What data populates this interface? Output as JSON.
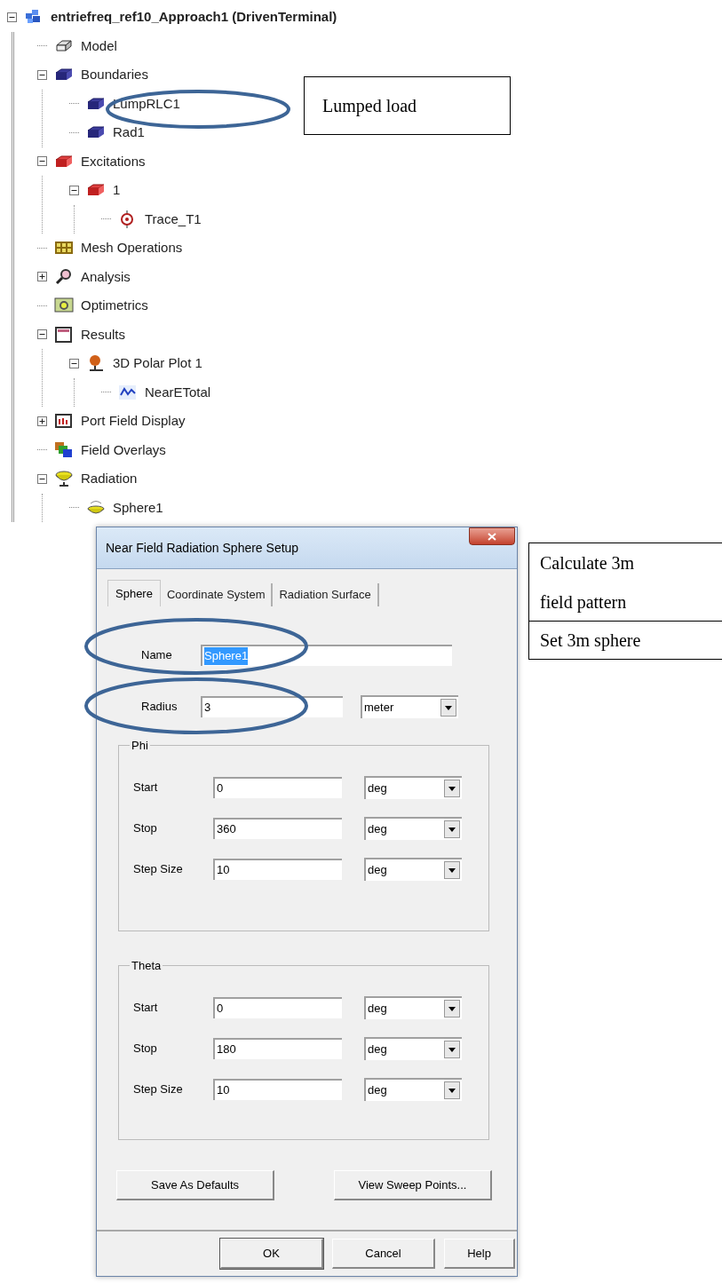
{
  "tree": [
    {
      "label": "entriefreq_ref10_Approach1 (DrivenTerminal)",
      "kind": "project",
      "expanded": true,
      "children": [
        {
          "label": "Model",
          "kind": "model"
        },
        {
          "label": "Boundaries",
          "kind": "boundary",
          "expanded": true,
          "children": [
            {
              "label": "LumpRLC1",
              "kind": "boundary"
            },
            {
              "label": "Rad1",
              "kind": "boundary"
            }
          ]
        },
        {
          "label": "Excitations",
          "kind": "excitation",
          "expanded": true,
          "children": [
            {
              "label": "1",
              "kind": "excitation",
              "expanded": true,
              "children": [
                {
                  "label": "Trace_T1",
                  "kind": "trace"
                }
              ]
            }
          ]
        },
        {
          "label": "Mesh Operations",
          "kind": "mesh"
        },
        {
          "label": "Analysis",
          "kind": "analysis",
          "expanded": false
        },
        {
          "label": "Optimetrics",
          "kind": "optimetrics"
        },
        {
          "label": "Results",
          "kind": "results",
          "expanded": true,
          "children": [
            {
              "label": "3D Polar Plot 1",
              "kind": "polar",
              "expanded": true,
              "children": [
                {
                  "label": "NearETotal",
                  "kind": "curve"
                }
              ]
            }
          ]
        },
        {
          "label": "Port Field Display",
          "kind": "port",
          "expanded": false
        },
        {
          "label": "Field Overlays",
          "kind": "overlays"
        },
        {
          "label": "Radiation",
          "kind": "radiation",
          "expanded": true,
          "children": [
            {
              "label": "Sphere1",
              "kind": "sphere"
            }
          ]
        }
      ]
    }
  ],
  "dialog": {
    "title": "Near Field Radiation Sphere Setup",
    "tabs": [
      {
        "label": "Sphere",
        "selected": true
      },
      {
        "label": "Coordinate System",
        "selected": false
      },
      {
        "label": "Radiation Surface",
        "selected": false
      }
    ],
    "name": {
      "label": "Name",
      "value": "Sphere1",
      "text_selected": true
    },
    "radius": {
      "label": "Radius",
      "value": "3",
      "unit": "meter"
    },
    "groups": [
      {
        "title": "Phi",
        "rows": [
          {
            "label": "Start",
            "value": "0",
            "unit": "deg"
          },
          {
            "label": "Stop",
            "value": "360",
            "unit": "deg"
          },
          {
            "label": "Step Size",
            "value": "10",
            "unit": "deg"
          }
        ]
      },
      {
        "title": "Theta",
        "rows": [
          {
            "label": "Start",
            "value": "0",
            "unit": "deg"
          },
          {
            "label": "Stop",
            "value": "180",
            "unit": "deg"
          },
          {
            "label": "Step Size",
            "value": "10",
            "unit": "deg"
          }
        ]
      }
    ],
    "buttons": [
      "Save As Defaults",
      "View Sweep Points..."
    ],
    "footer_buttons": [
      "OK",
      "Cancel",
      "Help"
    ]
  },
  "callouts": [
    {
      "text": "Lumped load"
    },
    {
      "text": "Calculate 3m field pattern"
    },
    {
      "text": "Set 3m sphere"
    }
  ]
}
